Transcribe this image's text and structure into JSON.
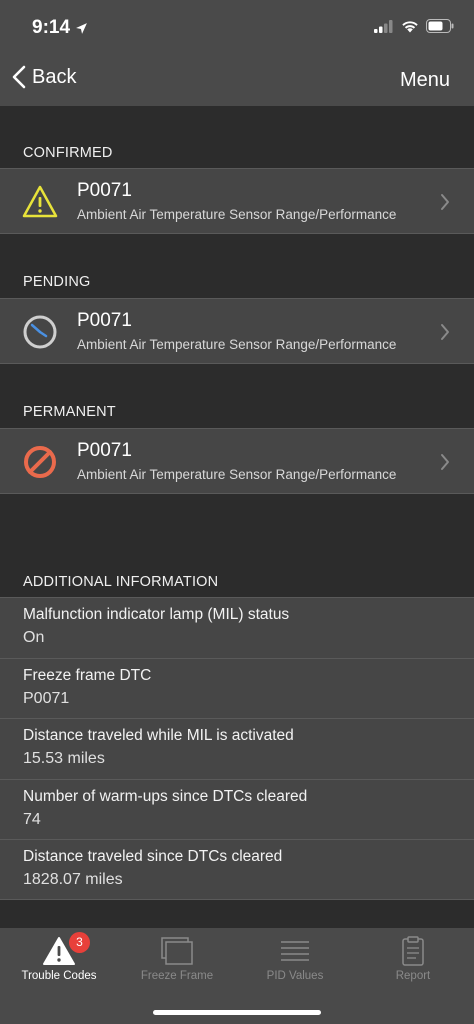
{
  "status_bar": {
    "time": "9:14"
  },
  "nav": {
    "back_label": "Back",
    "menu_label": "Menu"
  },
  "sections": {
    "confirmed": {
      "header": "CONFIRMED",
      "code": "P0071",
      "description": "Ambient Air Temperature Sensor Range/Performance",
      "icon": "warning-triangle-icon",
      "icon_color": "#e8e33a"
    },
    "pending": {
      "header": "PENDING",
      "code": "P0071",
      "description": "Ambient Air Temperature Sensor Range/Performance",
      "icon": "clock-icon",
      "icon_color": "#4a90e2"
    },
    "permanent": {
      "header": "PERMANENT",
      "code": "P0071",
      "description": "Ambient Air Temperature Sensor Range/Performance",
      "icon": "prohibited-icon",
      "icon_color": "#ea6a4c"
    }
  },
  "additional": {
    "header": "ADDITIONAL INFORMATION",
    "items": [
      {
        "label": "Malfunction indicator lamp (MIL) status",
        "value": "On"
      },
      {
        "label": "Freeze frame DTC",
        "value": "P0071"
      },
      {
        "label": "Distance traveled while MIL is activated",
        "value": "15.53 miles"
      },
      {
        "label": "Number of warm-ups since DTCs cleared",
        "value": "74"
      },
      {
        "label": "Distance traveled since DTCs cleared",
        "value": "1828.07 miles"
      }
    ]
  },
  "tabs": [
    {
      "label": "Trouble Codes",
      "icon": "warning-triangle-icon",
      "badge": "3",
      "active": true
    },
    {
      "label": "Freeze Frame",
      "icon": "frames-icon",
      "active": false
    },
    {
      "label": "PID Values",
      "icon": "list-icon",
      "active": false
    },
    {
      "label": "Report",
      "icon": "clipboard-icon",
      "active": false
    }
  ],
  "colors": {
    "background": "#2c2c2c",
    "bar": "#4a4a4a",
    "row": "#464646",
    "badge": "#e8403a"
  }
}
